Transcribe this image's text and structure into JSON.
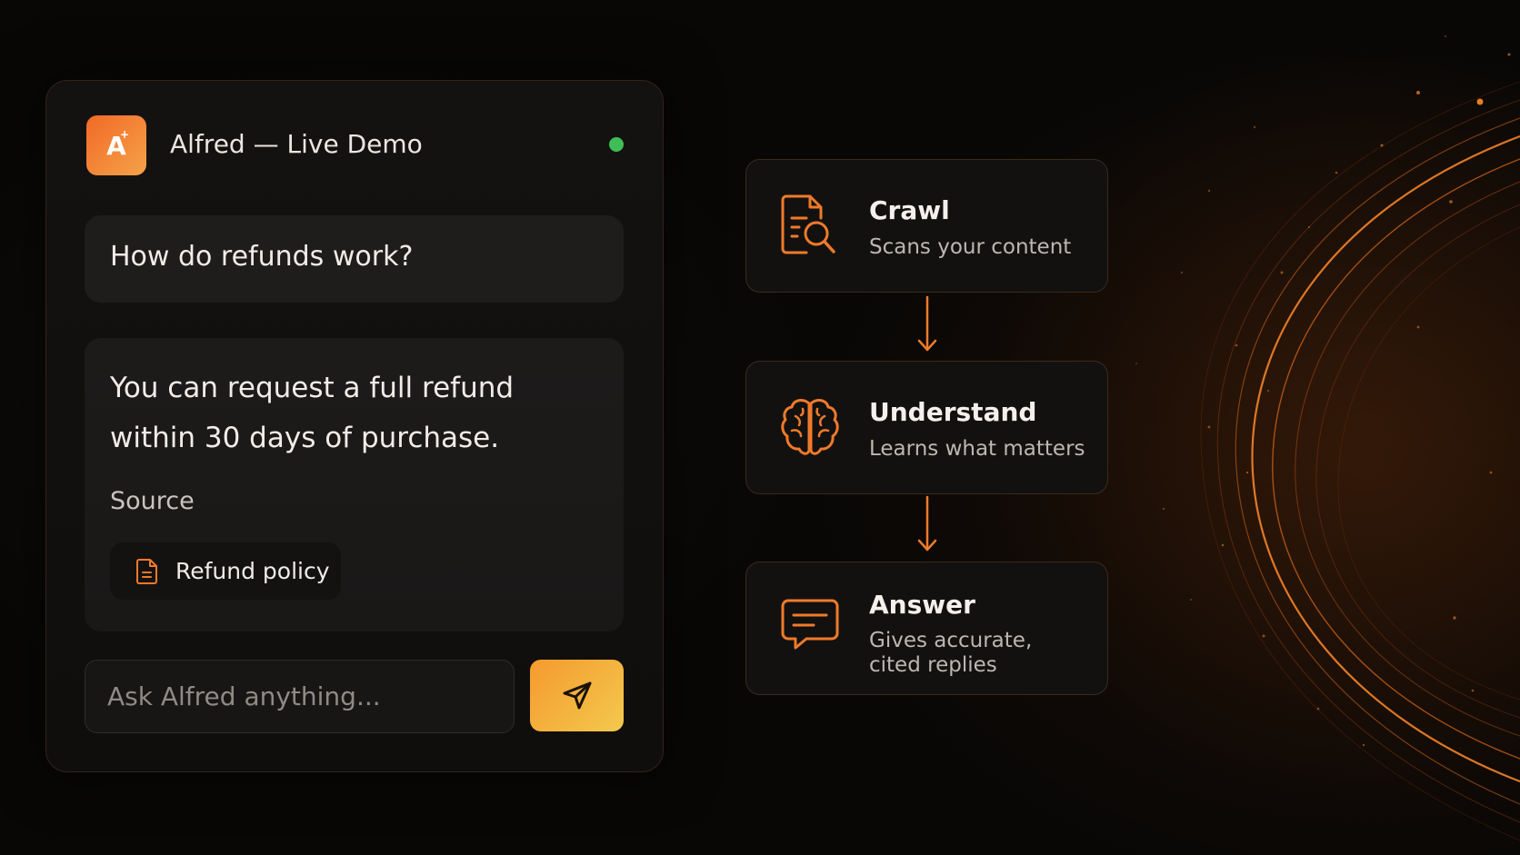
{
  "chat": {
    "logo_letter": "A",
    "logo_spark": "+",
    "title": "Alfred — Live Demo",
    "status_color": "#3fbd56",
    "user_message": "How do refunds work?",
    "bot_answer": "You can request a full refund within 30 days of purchase.",
    "source_label": "Source",
    "source_doc": "Refund policy",
    "input_placeholder": "Ask Alfred anything..."
  },
  "pipeline": {
    "steps": [
      {
        "title": "Crawl",
        "description": "Scans your content",
        "icon": "document-search-icon"
      },
      {
        "title": "Understand",
        "description": "Learns what matters",
        "icon": "brain-icon"
      },
      {
        "title": "Answer",
        "description_line1": "Gives accurate,",
        "description_line2": "cited replies",
        "icon": "chat-bubble-icon"
      }
    ]
  },
  "colors": {
    "accent_orange": "#f07a2a",
    "accent_yellow": "#f3c94e",
    "background": "#080706"
  }
}
